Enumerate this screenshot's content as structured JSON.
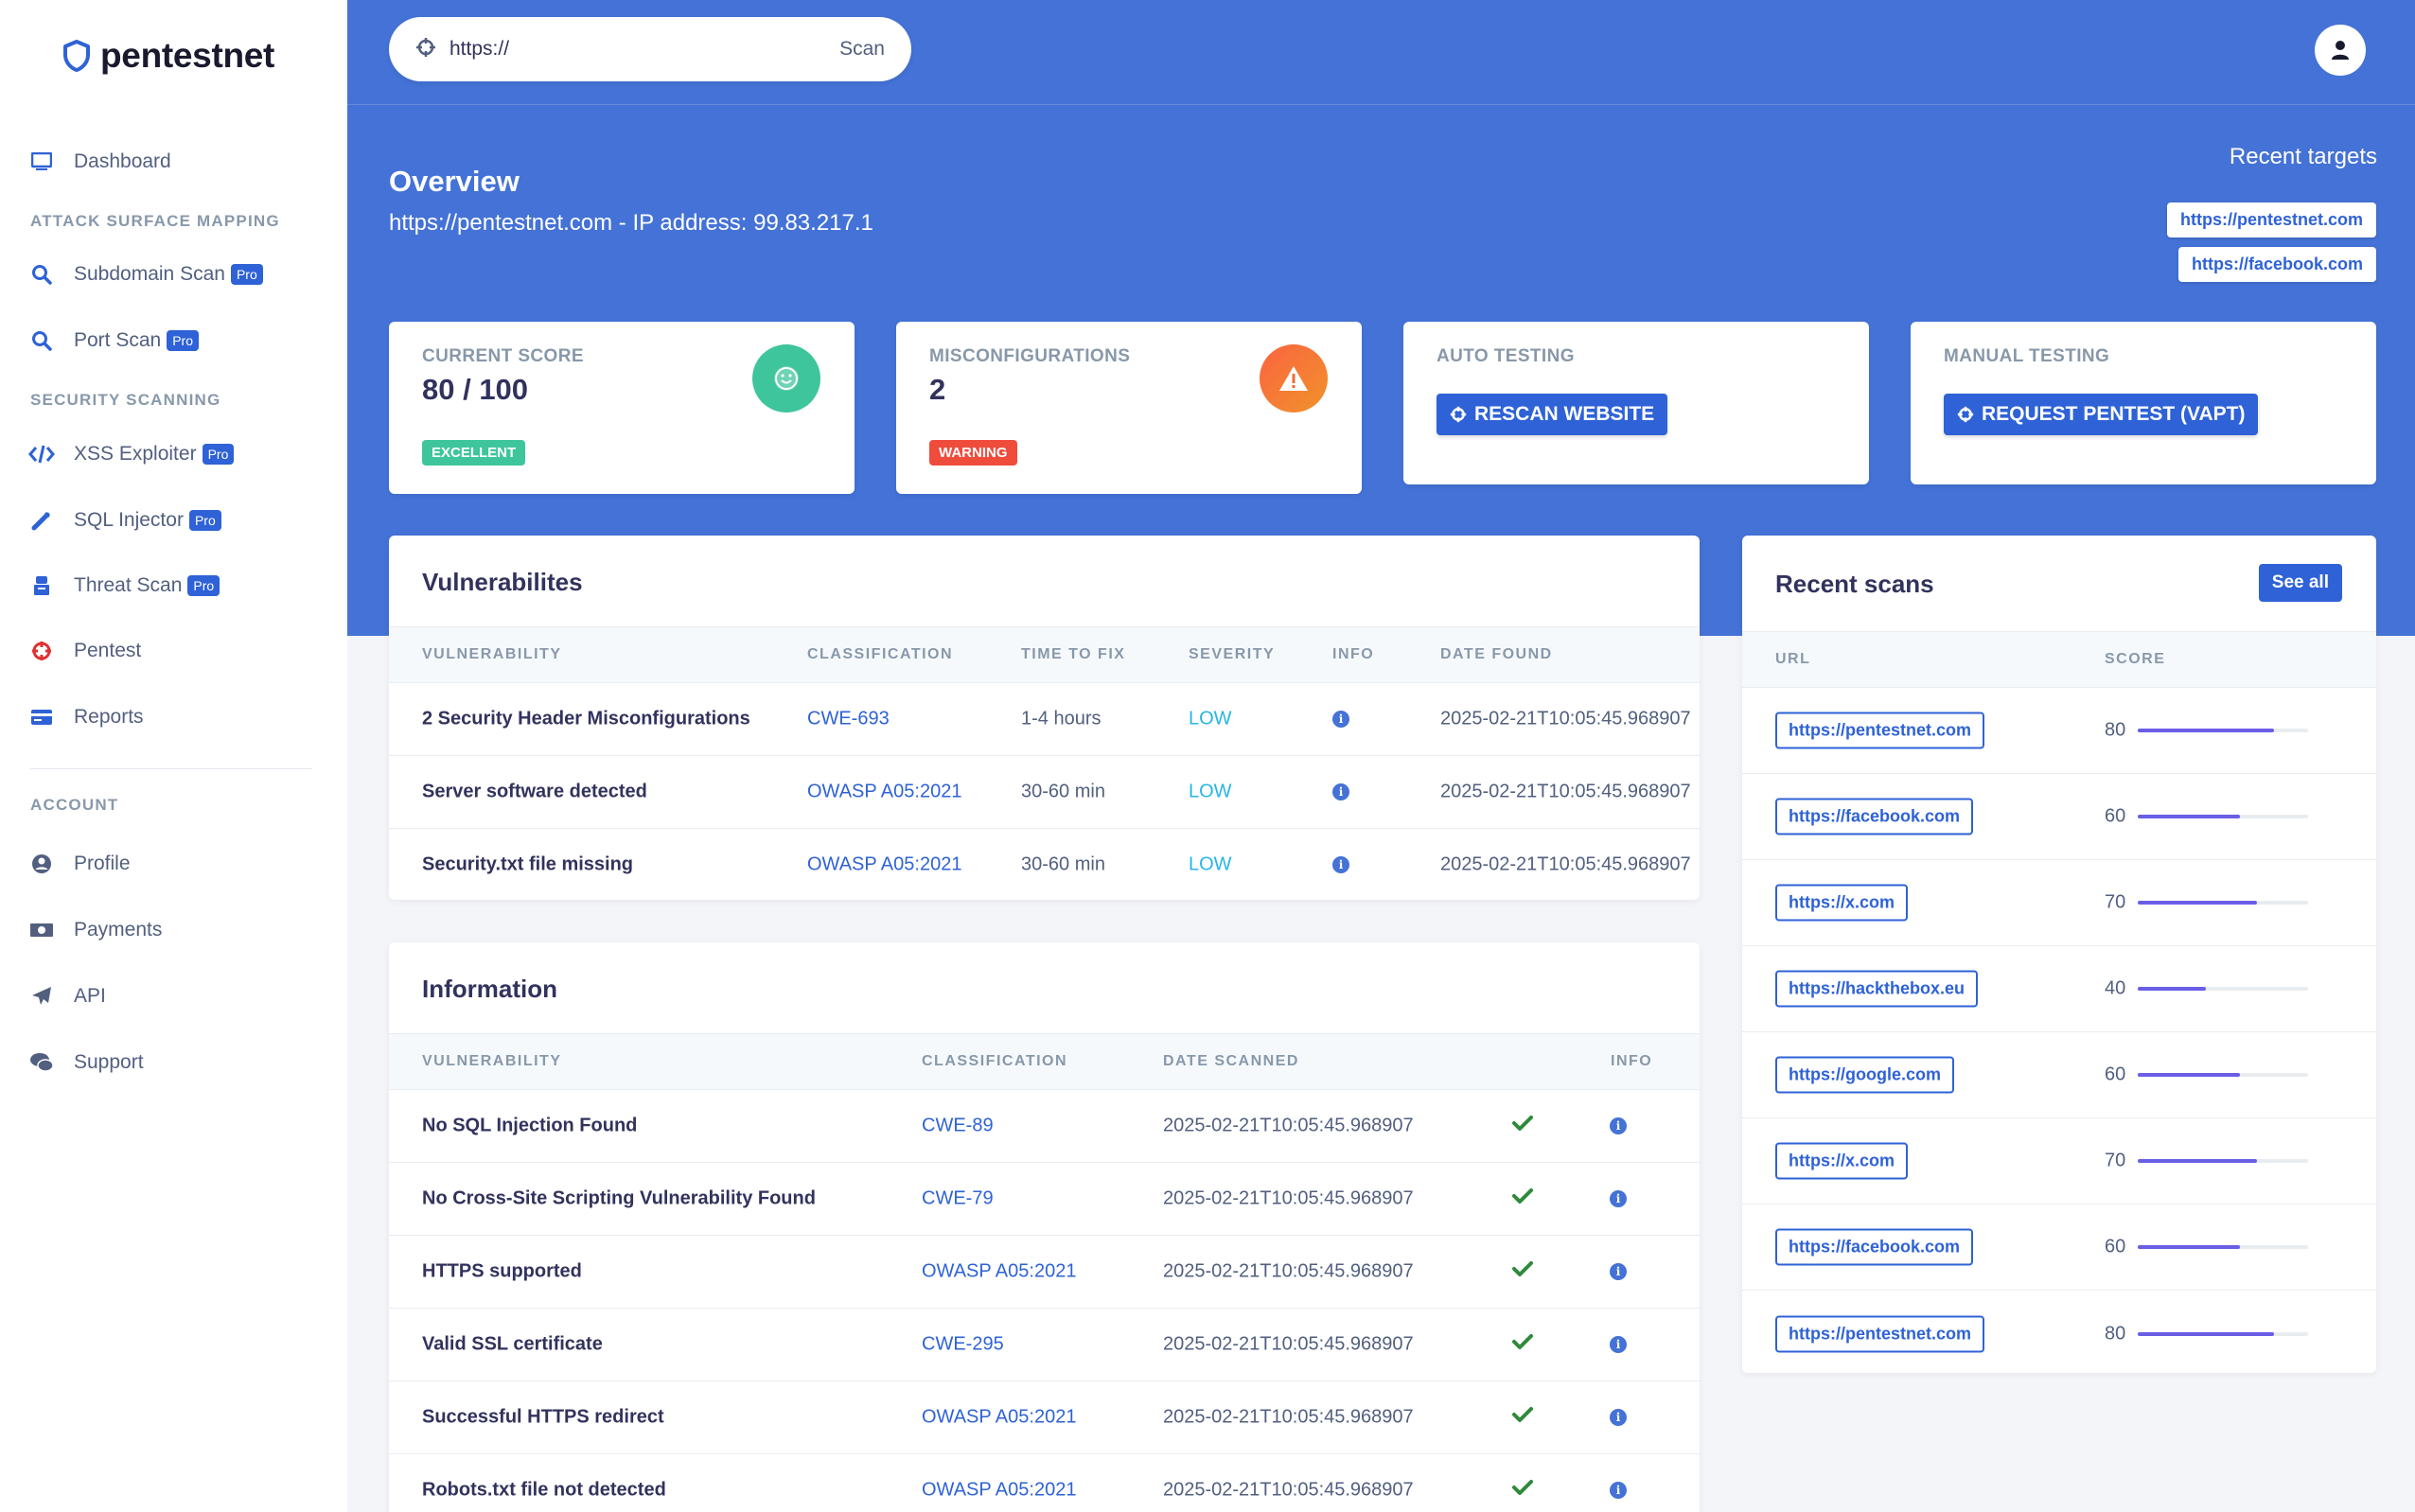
{
  "brand": {
    "name": "pentestnet"
  },
  "sidebar": {
    "items": [
      {
        "label": "Dashboard",
        "icon": "monitor-icon"
      },
      {
        "heading": "ATTACK SURFACE MAPPING"
      },
      {
        "label": "Subdomain Scan",
        "pro": "Pro",
        "icon": "search-icon"
      },
      {
        "label": "Port Scan",
        "pro": "Pro",
        "icon": "search-icon"
      },
      {
        "heading": "SECURITY SCANNING"
      },
      {
        "label": "XSS Exploiter",
        "pro": "Pro",
        "icon": "code-icon"
      },
      {
        "label": "SQL Injector",
        "pro": "Pro",
        "icon": "syringe-icon"
      },
      {
        "label": "Threat Scan",
        "pro": "Pro",
        "icon": "robot-icon"
      },
      {
        "label": "Pentest",
        "icon": "crosshair-icon"
      },
      {
        "label": "Reports",
        "icon": "card-icon"
      },
      {
        "heading": "ACCOUNT"
      },
      {
        "label": "Profile",
        "icon": "user-circle-icon"
      },
      {
        "label": "Payments",
        "icon": "money-icon"
      },
      {
        "label": "API",
        "icon": "paper-plane-icon"
      },
      {
        "label": "Support",
        "icon": "chat-icon"
      }
    ]
  },
  "search": {
    "value": "https://",
    "scan_label": "Scan"
  },
  "overview": {
    "title": "Overview",
    "subtitle": "https://pentestnet.com - IP address: 99.83.217.1",
    "recent_targets_title": "Recent targets",
    "recent_targets": [
      "https://pentestnet.com",
      "https://facebook.com"
    ]
  },
  "cards": {
    "score": {
      "label": "CURRENT SCORE",
      "value": "80 / 100",
      "badge": "EXCELLENT"
    },
    "misconfig": {
      "label": "MISCONFIGURATIONS",
      "value": "2",
      "badge": "WARNING"
    },
    "auto": {
      "label": "AUTO TESTING",
      "button": "RESCAN WEBSITE"
    },
    "manual": {
      "label": "MANUAL TESTING",
      "button": "REQUEST PENTEST (VAPT)"
    }
  },
  "vulnerabilities": {
    "title": "Vulnerabilites",
    "headers": [
      "VULNERABILITY",
      "CLASSIFICATION",
      "TIME TO FIX",
      "SEVERITY",
      "INFO",
      "DATE FOUND"
    ],
    "rows": [
      {
        "name": "2 Security Header Misconfigurations",
        "classification": "CWE-693",
        "time": "1-4 hours",
        "severity": "LOW",
        "date": "2025-02-21T10:05:45.968907"
      },
      {
        "name": "Server software detected",
        "classification": "OWASP A05:2021",
        "time": "30-60 min",
        "severity": "LOW",
        "date": "2025-02-21T10:05:45.968907"
      },
      {
        "name": "Security.txt file missing",
        "classification": "OWASP A05:2021",
        "time": "30-60 min",
        "severity": "LOW",
        "date": "2025-02-21T10:05:45.968907"
      }
    ]
  },
  "information": {
    "title": "Information",
    "headers": [
      "VULNERABILITY",
      "CLASSIFICATION",
      "DATE SCANNED",
      "INFO"
    ],
    "rows": [
      {
        "name": "No SQL Injection Found",
        "classification": "CWE-89",
        "date": "2025-02-21T10:05:45.968907"
      },
      {
        "name": "No Cross-Site Scripting Vulnerability Found",
        "classification": "CWE-79",
        "date": "2025-02-21T10:05:45.968907"
      },
      {
        "name": "HTTPS supported",
        "classification": "OWASP A05:2021",
        "date": "2025-02-21T10:05:45.968907"
      },
      {
        "name": "Valid SSL certificate",
        "classification": "CWE-295",
        "date": "2025-02-21T10:05:45.968907"
      },
      {
        "name": "Successful HTTPS redirect",
        "classification": "OWASP A05:2021",
        "date": "2025-02-21T10:05:45.968907"
      },
      {
        "name": "Robots.txt file not detected",
        "classification": "OWASP A05:2021",
        "date": "2025-02-21T10:05:45.968907"
      }
    ]
  },
  "recent_scans": {
    "title": "Recent scans",
    "see_all": "See all",
    "headers": [
      "URL",
      "SCORE"
    ],
    "rows": [
      {
        "url": "https://pentestnet.com",
        "score": 80
      },
      {
        "url": "https://facebook.com",
        "score": 60
      },
      {
        "url": "https://x.com",
        "score": 70
      },
      {
        "url": "https://hackthebox.eu",
        "score": 40
      },
      {
        "url": "https://google.com",
        "score": 60
      },
      {
        "url": "https://x.com",
        "score": 70
      },
      {
        "url": "https://facebook.com",
        "score": 60
      },
      {
        "url": "https://pentestnet.com",
        "score": 80
      }
    ]
  },
  "colors": {
    "accent": "#4472d6",
    "success": "#2dce89",
    "warning": "#f5365c",
    "score_bar": "#6a5ee6"
  }
}
